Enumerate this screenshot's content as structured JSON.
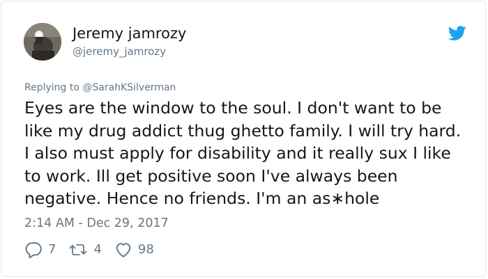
{
  "user": {
    "display_name": "Jeremy jamrozy",
    "handle": "@jeremy_jamrozy"
  },
  "reply": {
    "prefix": "Replying to ",
    "target": "@SarahKSilverman"
  },
  "tweet": {
    "text": "Eyes are the window to the soul. I don't want to be like my drug addict thug ghetto family. I will try hard. I also must apply for disability and it really sux I like to work. Ill get positive soon I've always been negative. Hence no friends. I'm an as∗hole",
    "timestamp": "2:14 AM - Dec 29, 2017"
  },
  "actions": {
    "replies": "7",
    "retweets": "4",
    "likes": "98"
  },
  "icons": {
    "brand": "twitter-bird-icon",
    "reply": "reply-bubble-icon",
    "retweet": "retweet-icon",
    "like": "heart-icon"
  },
  "colors": {
    "text_primary": "#14171a",
    "text_secondary": "#657786",
    "brand_blue": "#1da1f2",
    "border": "#e1e8ed"
  }
}
